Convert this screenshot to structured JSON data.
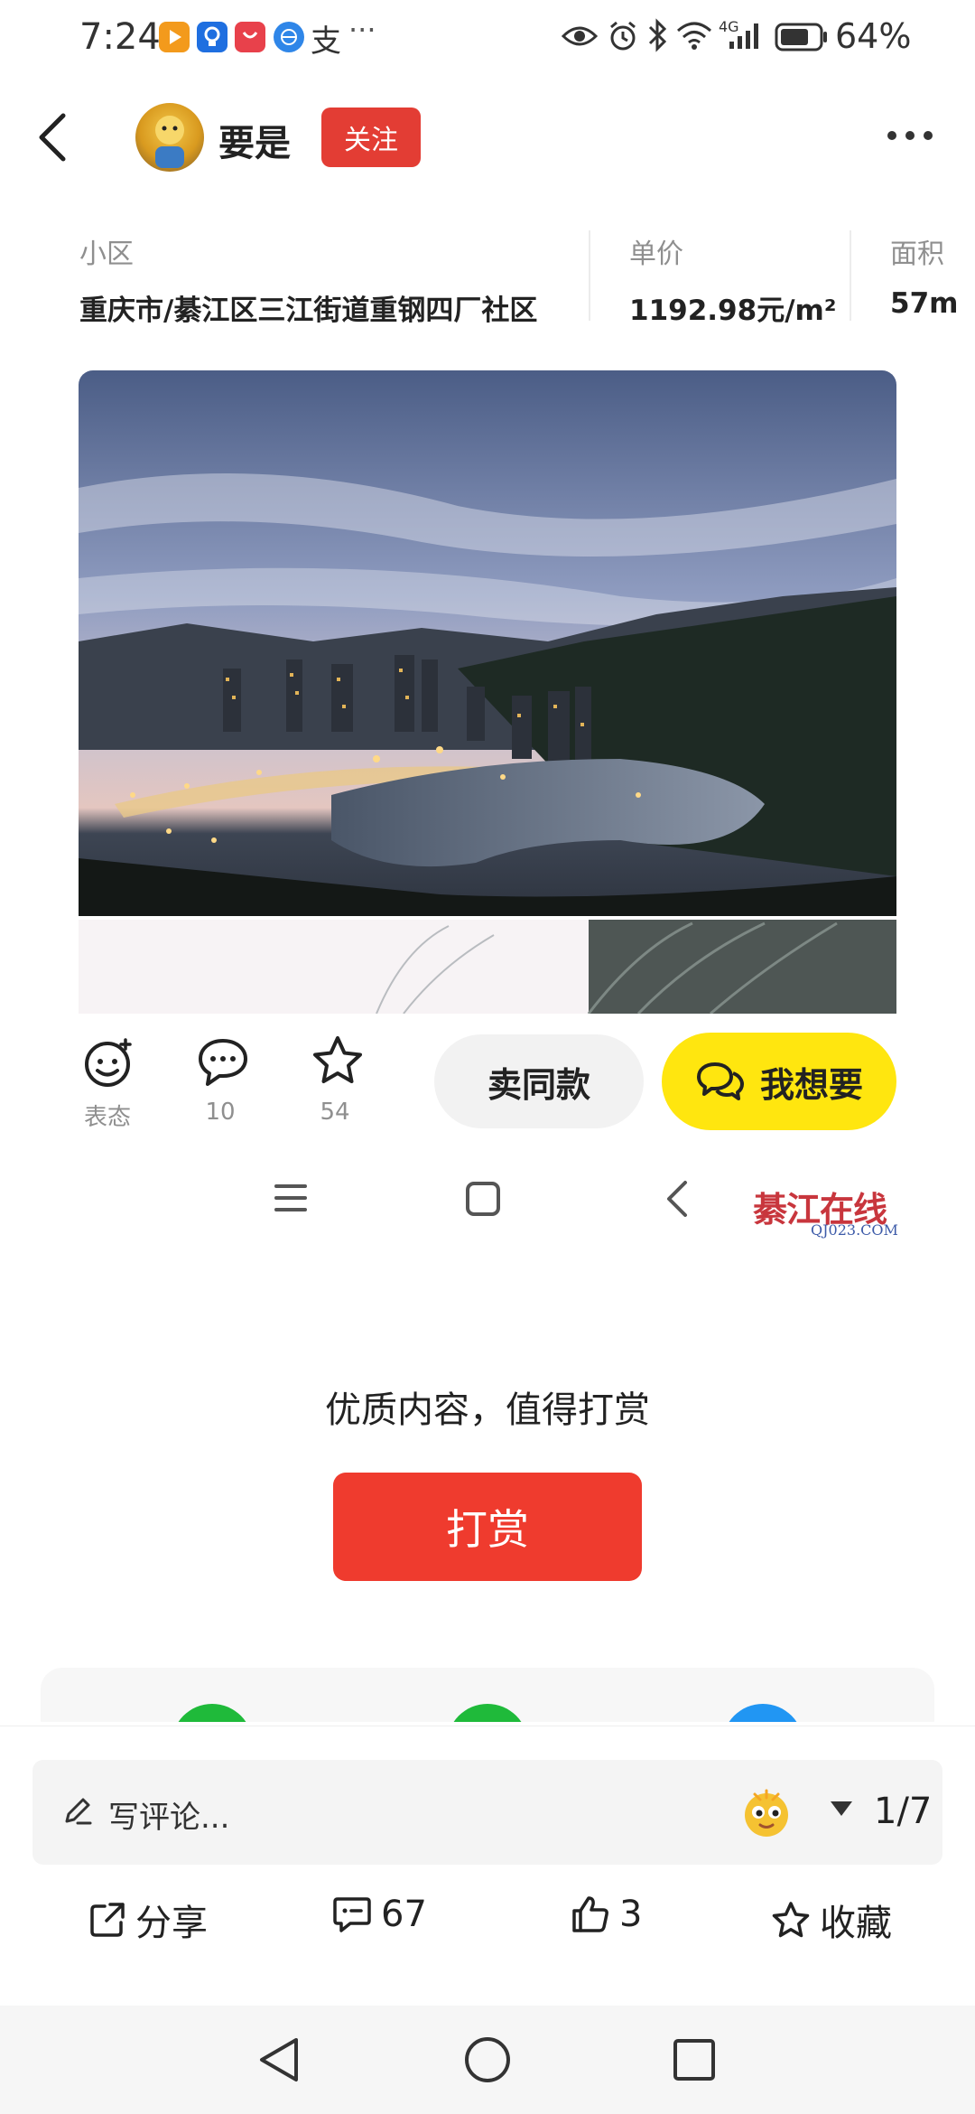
{
  "status_bar": {
    "time": "7:24",
    "more": "···",
    "alipay_glyph": "支",
    "network_label": "4G",
    "battery_text": "64%"
  },
  "header": {
    "user_name": "要是",
    "follow_label": "关注"
  },
  "info": {
    "community_label": "小区",
    "community_value": "重庆市/綦江区三江街道重钢四厂社区",
    "price_label": "单价",
    "price_value": "1192.98元/m²",
    "area_label": "面积",
    "area_value": "57m"
  },
  "actions": {
    "react_label": "表态",
    "comment_count": "10",
    "favorite_count": "54",
    "sell_same_label": "卖同款",
    "want_label": "我想要"
  },
  "watermark": {
    "main": "綦江在线",
    "sub": "QJ023.COM"
  },
  "reward": {
    "prompt": "优质内容，值得打赏",
    "button_label": "打赏"
  },
  "bottom_bar": {
    "comment_placeholder": "写评论...",
    "page_indicator": "1/7",
    "share_label": "分享",
    "comments_count": "67",
    "likes_count": "3",
    "collect_label": "收藏"
  },
  "colors": {
    "follow_red": "#e33d34",
    "want_yellow": "#ffe60f",
    "reward_red": "#ef3b2e"
  }
}
